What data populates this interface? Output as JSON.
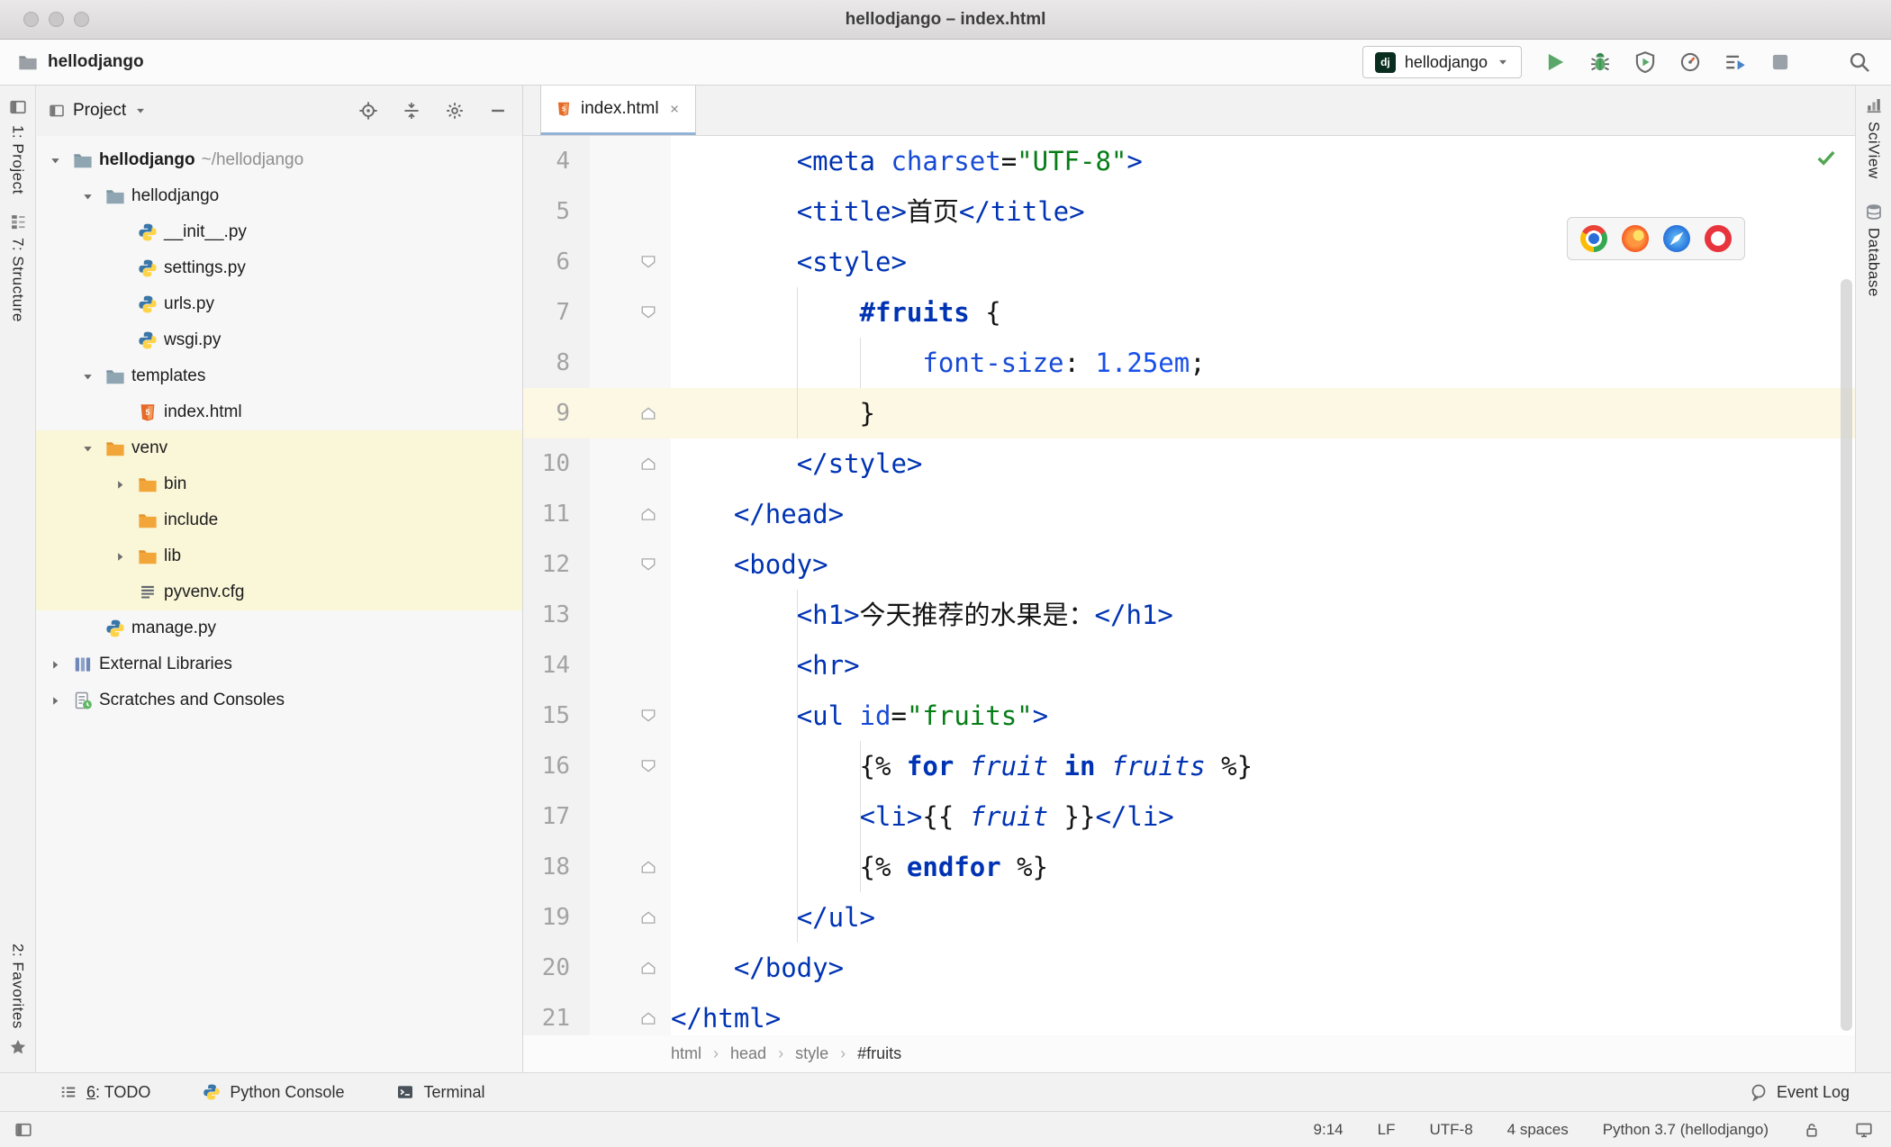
{
  "window": {
    "title": "hellodjango – index.html"
  },
  "toolbar": {
    "breadcrumb": "hellodjango",
    "run_config": "hellodjango",
    "dj_badge": "dj"
  },
  "left_strip": {
    "project": "1: Project",
    "structure": "7: Structure",
    "favorites": "2: Favorites"
  },
  "right_strip": {
    "sciview": "SciView",
    "database": "Database"
  },
  "project_panel": {
    "title": "Project",
    "tree": [
      {
        "label": "hellodjango",
        "suffix": " ~/hellodjango",
        "level": 0,
        "arrow": "open",
        "icon": "folder",
        "bold": true
      },
      {
        "label": "hellodjango",
        "level": 1,
        "arrow": "open",
        "icon": "folder"
      },
      {
        "label": "__init__.py",
        "level": 2,
        "arrow": "",
        "icon": "python"
      },
      {
        "label": "settings.py",
        "level": 2,
        "arrow": "",
        "icon": "python"
      },
      {
        "label": "urls.py",
        "level": 2,
        "arrow": "",
        "icon": "python"
      },
      {
        "label": "wsgi.py",
        "level": 2,
        "arrow": "",
        "icon": "python"
      },
      {
        "label": "templates",
        "level": 1,
        "arrow": "open",
        "icon": "folder"
      },
      {
        "label": "index.html",
        "level": 2,
        "arrow": "",
        "icon": "html"
      },
      {
        "label": "venv",
        "level": 1,
        "arrow": "open",
        "icon": "folderx",
        "highlight": true
      },
      {
        "label": "bin",
        "level": 2,
        "arrow": "closed",
        "icon": "folderx",
        "highlight": true
      },
      {
        "label": "include",
        "level": 2,
        "arrow": "",
        "icon": "folderx",
        "highlight": true
      },
      {
        "label": "lib",
        "level": 2,
        "arrow": "closed",
        "icon": "folderx",
        "highlight": true
      },
      {
        "label": "pyvenv.cfg",
        "level": 2,
        "arrow": "",
        "icon": "config",
        "highlight": true
      },
      {
        "label": "manage.py",
        "level": 1,
        "arrow": "",
        "icon": "python"
      },
      {
        "label": "External Libraries",
        "level": 0,
        "arrow": "closed",
        "icon": "lib"
      },
      {
        "label": "Scratches and Consoles",
        "level": 0,
        "arrow": "closed",
        "icon": "scratch"
      }
    ]
  },
  "editor": {
    "tab": "index.html",
    "breadcrumbs": [
      "html",
      "head",
      "style",
      "#fruits"
    ],
    "breadcrumb_separator": "›",
    "lines": [
      {
        "num": 4,
        "fold": "",
        "cur": false,
        "tokens": [
          [
            "txt",
            "        "
          ],
          [
            "tag",
            "<meta"
          ],
          [
            "txt",
            " "
          ],
          [
            "attr",
            "charset"
          ],
          [
            "txt",
            "="
          ],
          [
            "str",
            "\"UTF-8\""
          ],
          [
            "tag",
            ">"
          ]
        ]
      },
      {
        "num": 5,
        "fold": "",
        "cur": false,
        "tokens": [
          [
            "txt",
            "        "
          ],
          [
            "tag",
            "<title>"
          ],
          [
            "txt",
            "首页"
          ],
          [
            "tag",
            "</title>"
          ]
        ]
      },
      {
        "num": 6,
        "fold": "down",
        "cur": false,
        "tokens": [
          [
            "txt",
            "        "
          ],
          [
            "tag",
            "<style>"
          ]
        ]
      },
      {
        "num": 7,
        "fold": "down",
        "cur": false,
        "tokens": [
          [
            "txt",
            "            "
          ],
          [
            "sel",
            "#fruits"
          ],
          [
            "txt",
            " {"
          ]
        ]
      },
      {
        "num": 8,
        "fold": "",
        "cur": false,
        "tokens": [
          [
            "txt",
            "                "
          ],
          [
            "prop",
            "font-size"
          ],
          [
            "txt",
            ": "
          ],
          [
            "num",
            "1.25em"
          ],
          [
            "txt",
            ";"
          ]
        ]
      },
      {
        "num": 9,
        "fold": "up",
        "cur": true,
        "tokens": [
          [
            "txt",
            "            }"
          ]
        ]
      },
      {
        "num": 10,
        "fold": "up",
        "cur": false,
        "tokens": [
          [
            "txt",
            "        "
          ],
          [
            "tag",
            "</style>"
          ]
        ]
      },
      {
        "num": 11,
        "fold": "up",
        "cur": false,
        "tokens": [
          [
            "txt",
            "    "
          ],
          [
            "tag",
            "</head>"
          ]
        ]
      },
      {
        "num": 12,
        "fold": "down",
        "cur": false,
        "tokens": [
          [
            "txt",
            "    "
          ],
          [
            "tag",
            "<body>"
          ]
        ]
      },
      {
        "num": 13,
        "fold": "",
        "cur": false,
        "tokens": [
          [
            "txt",
            "        "
          ],
          [
            "tag",
            "<h1>"
          ],
          [
            "txt",
            "今天推荐的水果是："
          ],
          [
            "tag",
            "</h1>"
          ]
        ]
      },
      {
        "num": 14,
        "fold": "",
        "cur": false,
        "tokens": [
          [
            "txt",
            "        "
          ],
          [
            "tag",
            "<hr>"
          ]
        ]
      },
      {
        "num": 15,
        "fold": "down",
        "cur": false,
        "tokens": [
          [
            "txt",
            "        "
          ],
          [
            "tag",
            "<ul"
          ],
          [
            "txt",
            " "
          ],
          [
            "attr",
            "id"
          ],
          [
            "txt",
            "="
          ],
          [
            "str",
            "\"fruits\""
          ],
          [
            "tag",
            ">"
          ]
        ]
      },
      {
        "num": 16,
        "fold": "down",
        "cur": false,
        "tokens": [
          [
            "txt",
            "            {% "
          ],
          [
            "kw",
            "for"
          ],
          [
            "txt",
            " "
          ],
          [
            "var",
            "fruit"
          ],
          [
            "txt",
            " "
          ],
          [
            "kw",
            "in"
          ],
          [
            "txt",
            " "
          ],
          [
            "var",
            "fruits"
          ],
          [
            "txt",
            " %}"
          ]
        ]
      },
      {
        "num": 17,
        "fold": "",
        "cur": false,
        "tokens": [
          [
            "txt",
            "            "
          ],
          [
            "tag",
            "<li>"
          ],
          [
            "txt",
            "{{ "
          ],
          [
            "var",
            "fruit"
          ],
          [
            "txt",
            " }}"
          ],
          [
            "tag",
            "</li>"
          ]
        ]
      },
      {
        "num": 18,
        "fold": "up",
        "cur": false,
        "tokens": [
          [
            "txt",
            "            {% "
          ],
          [
            "kw",
            "endfor"
          ],
          [
            "txt",
            " %}"
          ]
        ]
      },
      {
        "num": 19,
        "fold": "up",
        "cur": false,
        "tokens": [
          [
            "txt",
            "        "
          ],
          [
            "tag",
            "</ul>"
          ]
        ]
      },
      {
        "num": 20,
        "fold": "up",
        "cur": false,
        "tokens": [
          [
            "txt",
            "    "
          ],
          [
            "tag",
            "</body>"
          ]
        ]
      },
      {
        "num": 21,
        "fold": "up",
        "cur": false,
        "tokens": [
          [
            "tag",
            "</html>"
          ]
        ]
      }
    ]
  },
  "bottom_bar": {
    "todo_mnemonic": "6",
    "todo_rest": ": TODO",
    "python_console": "Python Console",
    "terminal": "Terminal",
    "event_log": "Event Log"
  },
  "status_bar": {
    "caret": "9:14",
    "line_sep": "LF",
    "encoding": "UTF-8",
    "indent": "4 spaces",
    "interpreter": "Python 3.7 (hellodjango)"
  },
  "colors": {
    "run_green": "#59a869",
    "folder_excluded": "#f0a732",
    "tree_highlight": "#faf6d8",
    "caret_line": "#fcf8e3",
    "tag_blue": "#0033b3",
    "string_green": "#067d17",
    "django_dark": "#092e20"
  }
}
